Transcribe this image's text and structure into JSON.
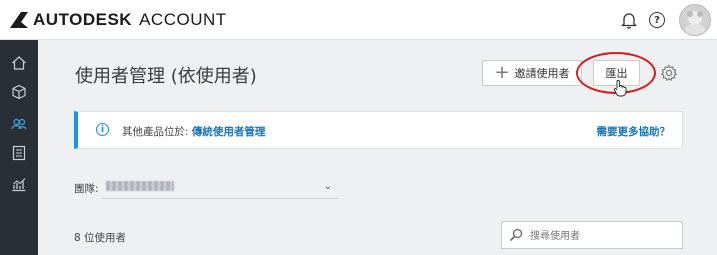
{
  "header": {
    "brand": "AUTODESK",
    "brand_suffix": "ACCOUNT",
    "help_glyph": "?"
  },
  "sidebar": {
    "items": [
      {
        "icon": "home-icon"
      },
      {
        "icon": "cube-icon"
      },
      {
        "icon": "users-icon"
      },
      {
        "icon": "document-icon"
      },
      {
        "icon": "chart-icon"
      }
    ]
  },
  "main": {
    "title": "使用者管理 (依使用者)",
    "invite_label": "邀請使用者",
    "export_label": "匯出",
    "info": {
      "icon_glyph": "i",
      "prefix": "其他產品位於: ",
      "link": "傳統使用者管理",
      "help": "需要更多協助？"
    },
    "team_label": "團隊:",
    "team_value_redacted": true,
    "user_count": "8 位使用者",
    "search_placeholder": "搜尋使用者"
  },
  "colors": {
    "accent": "#1a96d6",
    "link": "#1a74b8",
    "sidebar": "#2a2f36",
    "highlight_ring": "#d51d1d"
  }
}
